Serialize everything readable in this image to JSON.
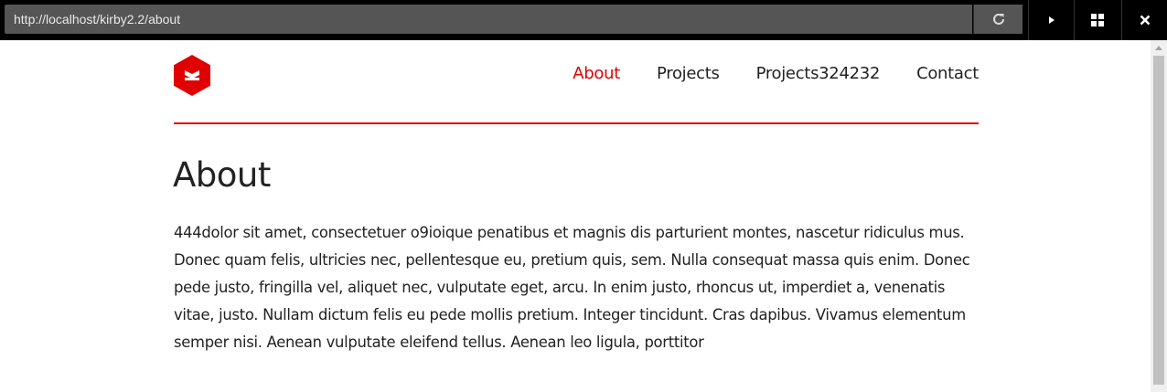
{
  "browser": {
    "url": "http://localhost/kirby2.2/about",
    "icons": [
      "reload-icon",
      "play-icon",
      "grid-icon",
      "close-icon"
    ]
  },
  "site": {
    "nav": [
      {
        "label": "About",
        "active": true
      },
      {
        "label": "Projects",
        "active": false
      },
      {
        "label": "Projects324232",
        "active": false
      },
      {
        "label": "Contact",
        "active": false
      }
    ],
    "accent_color": "#e00000"
  },
  "content": {
    "heading": "About",
    "paragraph": "444dolor sit amet, consectetuer o9ioique penatibus et magnis dis parturient montes, nascetur ridiculus mus. Donec quam felis, ultricies nec, pellentesque eu, pretium quis, sem. Nulla consequat massa quis enim. Donec pede justo, fringilla vel, aliquet nec, vulputate eget, arcu. In enim justo, rhoncus ut, imperdiet a, venenatis vitae, justo. Nullam dictum felis eu pede mollis pretium. Integer tincidunt. Cras dapibus. Vivamus elementum semper nisi. Aenean vulputate eleifend tellus. Aenean leo ligula, porttitor"
  }
}
